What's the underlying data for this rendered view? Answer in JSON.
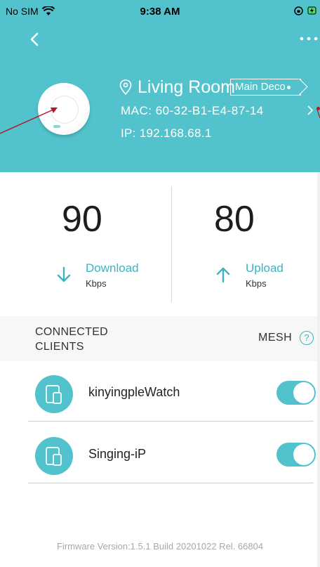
{
  "status_bar": {
    "carrier": "No SIM",
    "time": "9:38 AM"
  },
  "device": {
    "name": "Living Room",
    "badge": "Main Deco",
    "mac": "MAC: 60-32-B1-E4-87-14",
    "ip": "IP: 192.168.68.1"
  },
  "speed": {
    "download_value": "90",
    "download_label": "Download",
    "download_unit": "Kbps",
    "upload_value": "80",
    "upload_label": "Upload",
    "upload_unit": "Kbps"
  },
  "section": {
    "title": "CONNECTED CLIENTS",
    "mesh_label": "MESH",
    "help_label": "?"
  },
  "clients": [
    {
      "name": "kinyingpleWatch",
      "enabled": true
    },
    {
      "name": "Singing-iP",
      "enabled": true
    }
  ],
  "footer": {
    "firmware": "Firmware Version:1.5.1 Build 20201022 Rel. 66804"
  },
  "colors": {
    "accent": "#52c3cc",
    "annotation": "#b5162b"
  }
}
